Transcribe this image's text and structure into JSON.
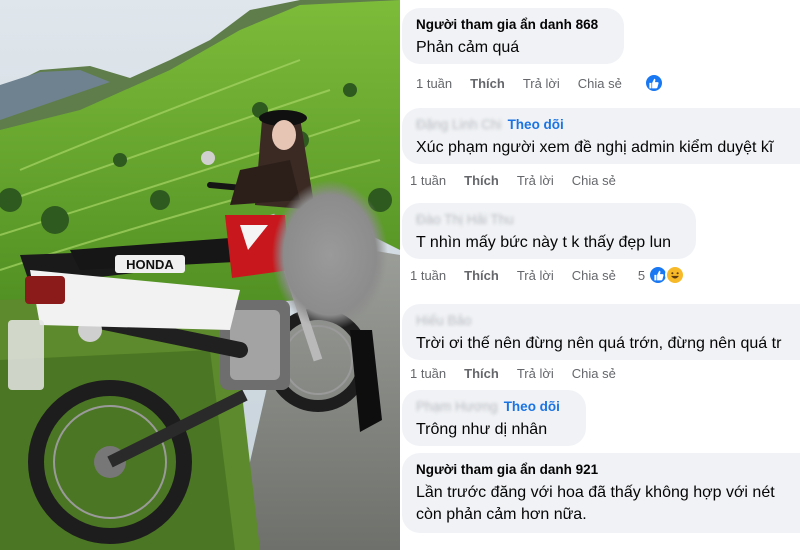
{
  "comments": [
    {
      "author": "Người tham gia ẩn danh 868",
      "text": "Phản cảm quá",
      "time": "1 tuần",
      "like": "Thích",
      "reply": "Trả lời",
      "share": "Chia sẻ"
    },
    {
      "author": "Đặng Linh Chi",
      "follow": "Theo dõi",
      "text": "Xúc phạm người xem đề nghị admin kiểm duyệt kĩ",
      "time": "1 tuần",
      "like": "Thích",
      "reply": "Trả lời",
      "share": "Chia sẻ"
    },
    {
      "author": "Đào Thị Hải Thu",
      "text": "T nhìn mấy bức này t k thấy đẹp lun",
      "time": "1 tuần",
      "like": "Thích",
      "reply": "Trả lời",
      "share": "Chia sẻ",
      "reaction_count": "5"
    },
    {
      "author": "Hiếu Bảo",
      "text": "Trời ơi thế nên đừng nên quá trớn, đừng nên quá tr",
      "time": "1 tuần",
      "like": "Thích",
      "reply": "Trả lời",
      "share": "Chia sẻ"
    },
    {
      "author": "Phạm Hương",
      "follow": "Theo dõi",
      "text": "Trông như dị nhân"
    },
    {
      "author": "Người tham gia ẩn danh 921",
      "text_line1": "Lần trước đăng với hoa đã thấy không hợp với nét",
      "text_line2": "còn phản cảm hơn nữa."
    }
  ],
  "photo": {
    "bike_brand": "HONDA"
  },
  "colors": {
    "bubble": "#f0f2f5",
    "link": "#1b74e4",
    "meta": "#65676b",
    "like_icon": "#1877f2",
    "haha_icon": "#f7b928"
  },
  "icons": [
    "like-reaction-icon",
    "haha-reaction-icon"
  ]
}
